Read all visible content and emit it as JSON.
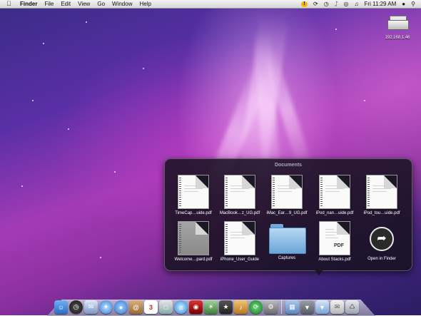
{
  "menubar": {
    "apple": "",
    "items": [
      "Finder",
      "File",
      "Edit",
      "View",
      "Go",
      "Window",
      "Help"
    ],
    "clock": "Fri 11:29 AM"
  },
  "desktop": {
    "printer_label": "192.168.1.46"
  },
  "stack": {
    "title": "Documents",
    "items": [
      {
        "label": "TimeCap…uide.pdf",
        "kind": "pdf"
      },
      {
        "label": "MacBook…z_UG.pdf",
        "kind": "pdf"
      },
      {
        "label": "iMac_Ear…9_UG.pdf",
        "kind": "pdf"
      },
      {
        "label": "iPod_nan…uide.pdf",
        "kind": "pdf"
      },
      {
        "label": "iPod_tou…uide.pdf",
        "kind": "pdf"
      },
      {
        "label": "Welcome…pard.pdf",
        "kind": "pdf-dark"
      },
      {
        "label": "iPhone_User_Guide",
        "kind": "pdf"
      },
      {
        "label": "Captures",
        "kind": "folder"
      },
      {
        "label": "About Stacks.pdf",
        "kind": "pdf-preview"
      },
      {
        "label": "Open in Finder",
        "kind": "finder"
      }
    ]
  },
  "dock": {
    "icons": [
      "finder-icon",
      "dashboard-icon",
      "mail-icon",
      "safari-icon",
      "ichat-icon",
      "address-book-icon",
      "ical-icon",
      "preview-icon",
      "itunes-icon",
      "photobooth-icon",
      "iphoto-icon",
      "imovie-icon",
      "garageband-icon",
      "time-machine-icon",
      "system-preferences-icon",
      "applications-stack-icon",
      "documents-stack-icon",
      "downloads-stack-icon",
      "mail-stack-icon",
      "trash-icon"
    ],
    "colors": {
      "accent": "#6fa9da",
      "brand": "#a43bb6"
    }
  }
}
